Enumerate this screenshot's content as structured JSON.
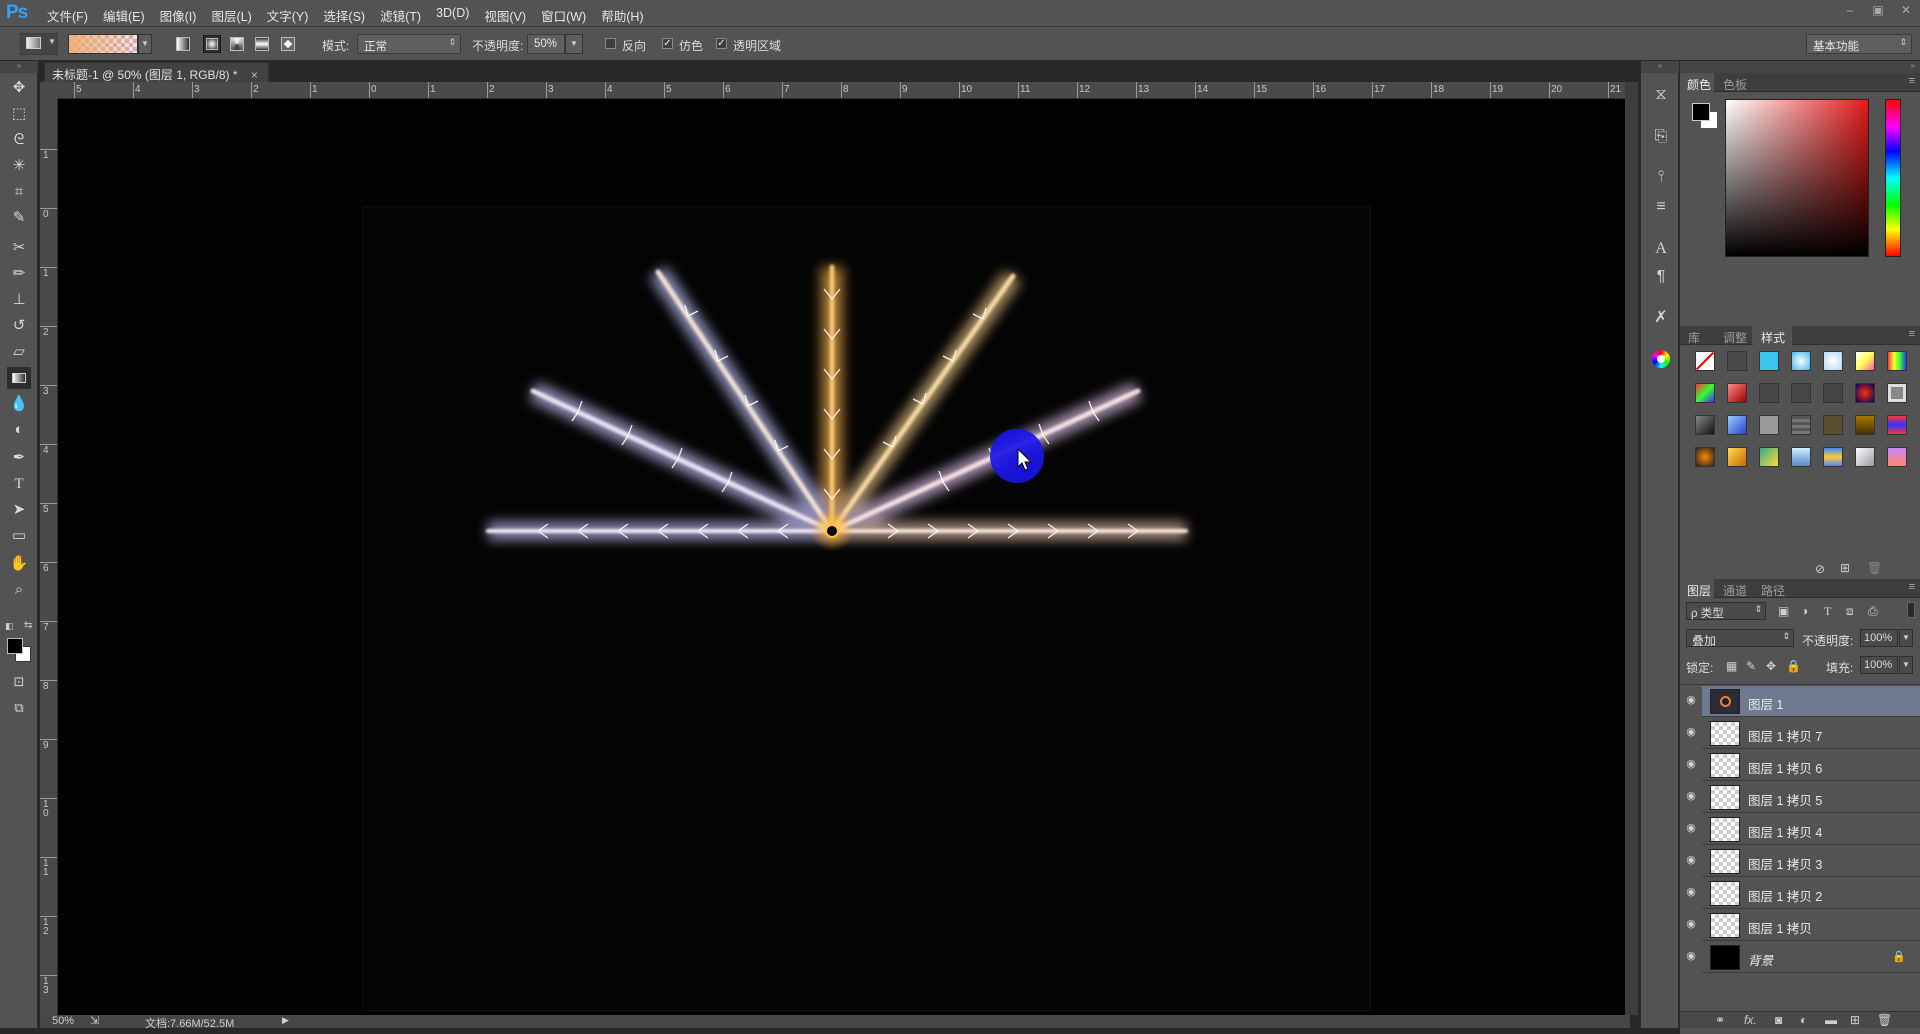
{
  "app": {
    "logo": "Ps"
  },
  "menu": [
    "文件(F)",
    "编辑(E)",
    "图像(I)",
    "图层(L)",
    "文字(Y)",
    "选择(S)",
    "滤镜(T)",
    "3D(D)",
    "视图(V)",
    "窗口(W)",
    "帮助(H)"
  ],
  "window_controls": {
    "minimize": "–",
    "restore": "▣",
    "close": "✕"
  },
  "options": {
    "mode_label": "模式:",
    "mode_value": "正常",
    "opacity_label": "不透明度:",
    "opacity_value": "50%",
    "reverse_label": "反向",
    "dither_label": "仿色",
    "transparency_label": "透明区域",
    "workspace_value": "基本功能"
  },
  "document": {
    "tab_title": "未标题-1 @ 50% (图层 1, RGB/8) *",
    "close": "×"
  },
  "ruler_h": [
    "5",
    "4",
    "3",
    "2",
    "1",
    "0",
    "1",
    "2",
    "3",
    "4",
    "5",
    "6",
    "7",
    "8",
    "9",
    "10",
    "11",
    "12",
    "13",
    "14",
    "15",
    "16",
    "17",
    "18",
    "19",
    "20",
    "21"
  ],
  "ruler_v": [
    "1",
    "0",
    "1",
    "2",
    "3",
    "4",
    "5",
    "6",
    "7",
    "8",
    "9",
    "10",
    "11",
    "12",
    "13"
  ],
  "status": {
    "zoom": "50%",
    "doc_info": "文档:7.66M/52.5M"
  },
  "panels": {
    "color_tabs": [
      "颜色",
      "色板"
    ],
    "style_tabs": [
      "库",
      "调整",
      "样式"
    ],
    "layer_tabs": [
      "图层",
      "通道",
      "路径"
    ],
    "layer_filter": "ρ 类型",
    "blend_mode": "叠加",
    "opacity_label": "不透明度:",
    "opacity_value": "100%",
    "lock_label": "锁定:",
    "fill_label": "填充:",
    "fill_value": "100%"
  },
  "layers": [
    {
      "name": "图层 1",
      "selected": true
    },
    {
      "name": "图层 1 拷贝 7",
      "selected": false
    },
    {
      "name": "图层 1 拷贝 6",
      "selected": false
    },
    {
      "name": "图层 1 拷贝 5",
      "selected": false
    },
    {
      "name": "图层 1 拷贝 4",
      "selected": false
    },
    {
      "name": "图层 1 拷贝 3",
      "selected": false
    },
    {
      "name": "图层 1 拷贝 2",
      "selected": false
    },
    {
      "name": "图层 1 拷贝",
      "selected": false
    },
    {
      "name": "背景",
      "selected": false
    }
  ],
  "colors": {
    "accent": "#2fa3ff",
    "selected_layer": "#6d7a8f",
    "cursor_blob": "#1a16e8"
  }
}
